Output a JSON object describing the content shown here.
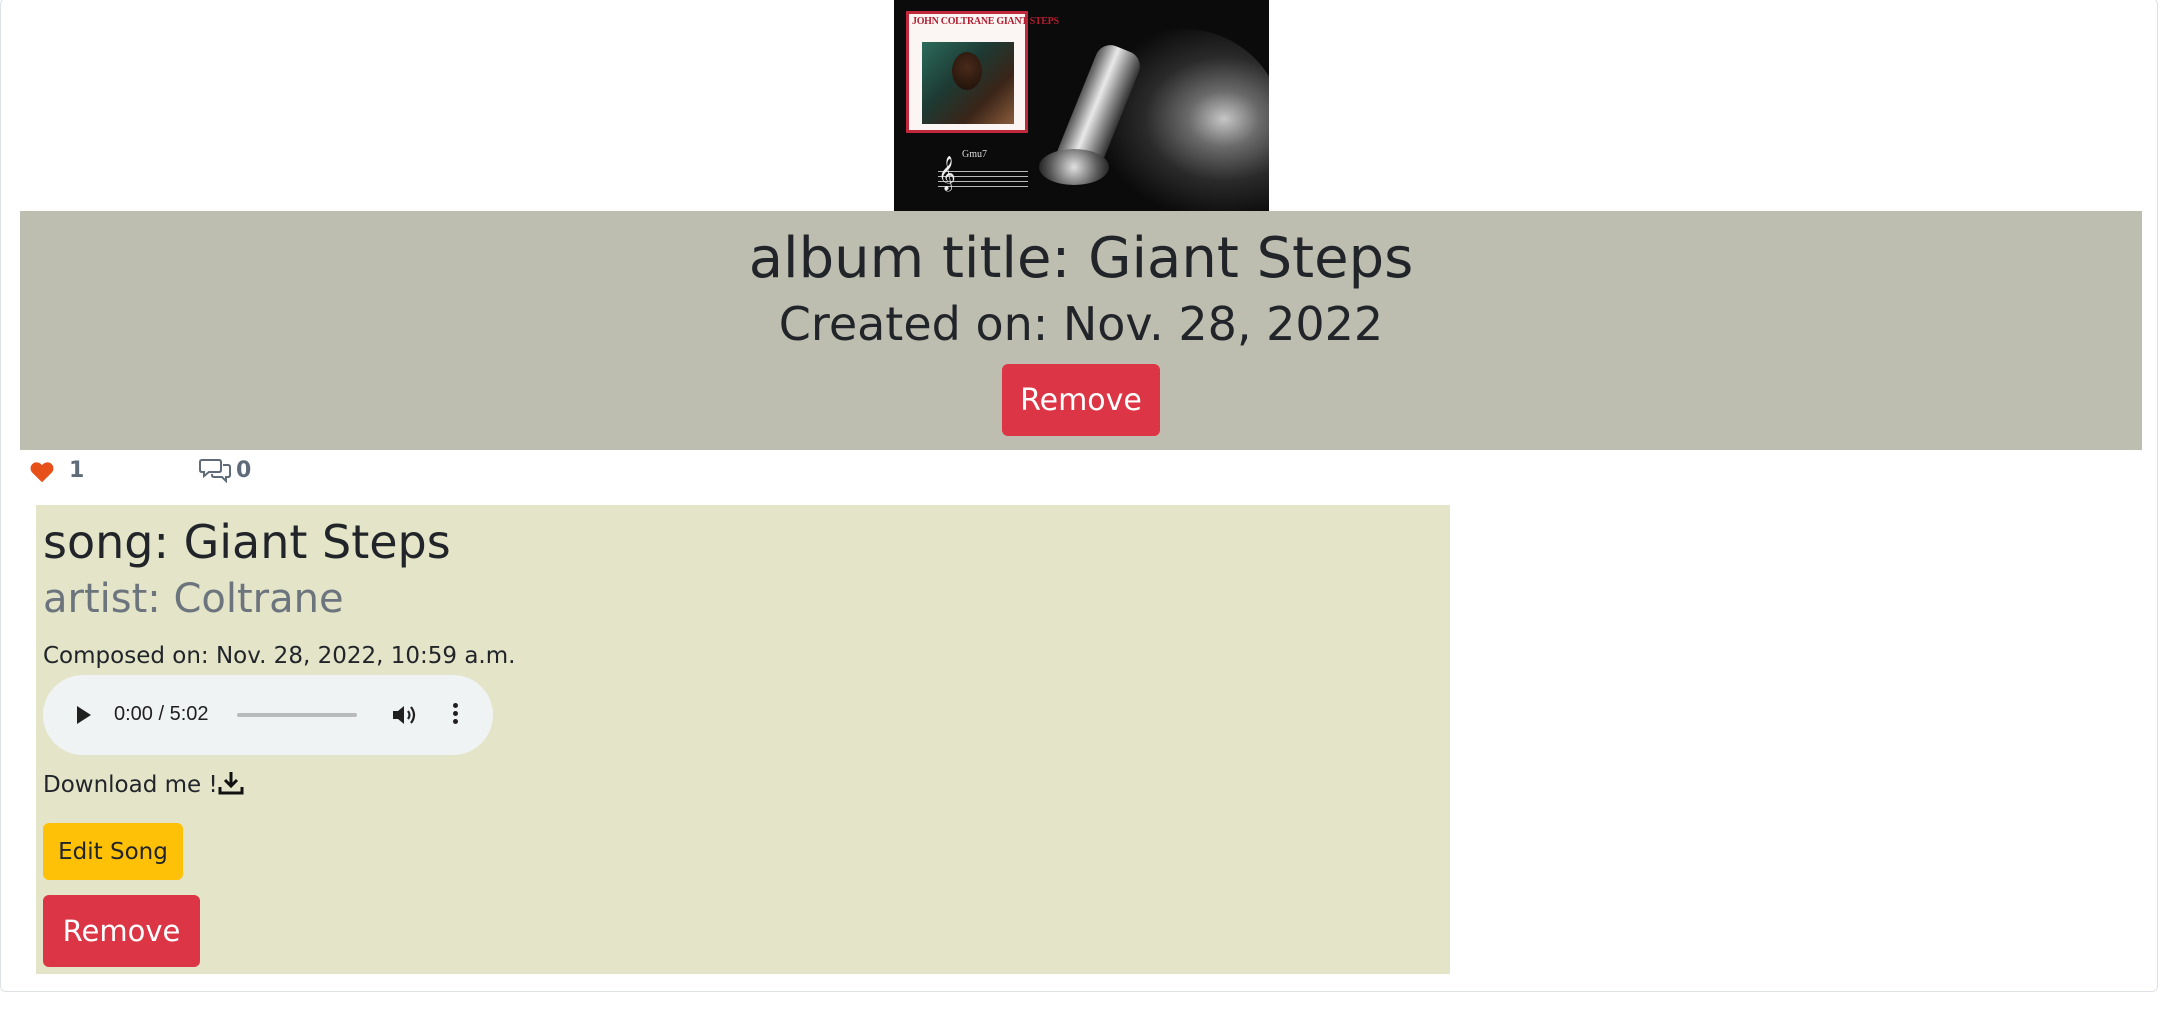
{
  "album": {
    "cover_label": "JOHN COLTRANE GIANT STEPS",
    "cover_chord": "Gmu7",
    "title": "album title: Giant Steps",
    "created": "Created on: Nov. 28, 2022",
    "remove_label": "Remove"
  },
  "stats": {
    "likes": "1",
    "comments": "0",
    "heart_color": "#e8501a"
  },
  "song": {
    "title": "song: Giant Steps",
    "artist": "artist: Coltrane",
    "composed": "Composed on: Nov. 28, 2022, 10:59 a.m.",
    "player": {
      "time": "0:00 / 5:02",
      "progress_fraction": 0
    },
    "download_label": "Download me !",
    "edit_label": "Edit Song",
    "remove_label": "Remove"
  },
  "colors": {
    "album_band": "#bebeb0",
    "song_panel": "#e4e4c9",
    "danger": "#dc3545",
    "warning": "#ffc107"
  }
}
